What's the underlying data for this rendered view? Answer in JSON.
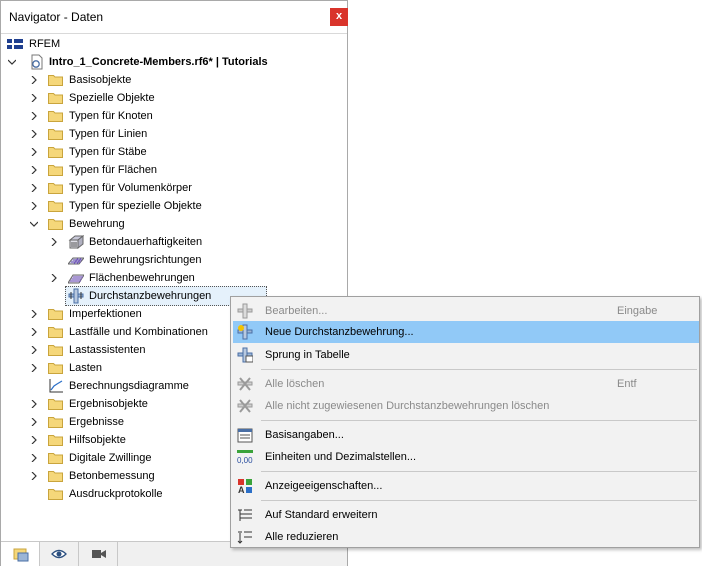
{
  "window": {
    "title": "Navigator - Daten",
    "close_label": "x"
  },
  "tree": {
    "root_label": "RFEM",
    "project_label": "Intro_1_Concrete-Members.rf6* | Tutorials",
    "items": [
      {
        "label": "Basisobjekte"
      },
      {
        "label": "Spezielle Objekte"
      },
      {
        "label": "Typen für Knoten"
      },
      {
        "label": "Typen für Linien"
      },
      {
        "label": "Typen für Stäbe"
      },
      {
        "label": "Typen für Flächen"
      },
      {
        "label": "Typen für Volumenkörper"
      },
      {
        "label": "Typen für spezielle Objekte"
      },
      {
        "label": "Bewehrung"
      },
      {
        "label": "Imperfektionen"
      },
      {
        "label": "Lastfälle und Kombinationen"
      },
      {
        "label": "Lastassistenten"
      },
      {
        "label": "Lasten"
      },
      {
        "label": "Berechnungsdiagramme"
      },
      {
        "label": "Ergebnisobjekte"
      },
      {
        "label": "Ergebnisse"
      },
      {
        "label": "Hilfsobjekte"
      },
      {
        "label": "Digitale Zwillinge"
      },
      {
        "label": "Betonbemessung"
      },
      {
        "label": "Ausdruckprotokolle"
      }
    ],
    "bewehrung_children": [
      {
        "label": "Betondauerhaftigkeiten"
      },
      {
        "label": "Bewehrungsrichtungen"
      },
      {
        "label": "Flächenbewehrungen"
      },
      {
        "label": "Durchstanzbewehrungen"
      }
    ]
  },
  "context_menu": {
    "items": [
      {
        "label": "Bearbeiten...",
        "shortcut": "Eingabe",
        "disabled": true
      },
      {
        "label": "Neue Durchstanzbewehrung...",
        "shortcut": "",
        "highlighted": true
      },
      {
        "label": "Sprung in Tabelle",
        "shortcut": ""
      },
      {
        "label": "Alle löschen",
        "shortcut": "Entf",
        "disabled": true
      },
      {
        "label": "Alle nicht zugewiesenen Durchstanzbewehrungen löschen",
        "shortcut": "",
        "disabled": true
      },
      {
        "label": "Basisangaben...",
        "shortcut": ""
      },
      {
        "label": "Einheiten und Dezimalstellen...",
        "shortcut": ""
      },
      {
        "label": "Anzeigeeigenschaften...",
        "shortcut": ""
      },
      {
        "label": "Auf Standard erweitern",
        "shortcut": ""
      },
      {
        "label": "Alle reduzieren",
        "shortcut": ""
      }
    ]
  },
  "colors": {
    "highlight": "#91c9f7",
    "close": "#d9342b",
    "folder": "#f5d77a"
  }
}
